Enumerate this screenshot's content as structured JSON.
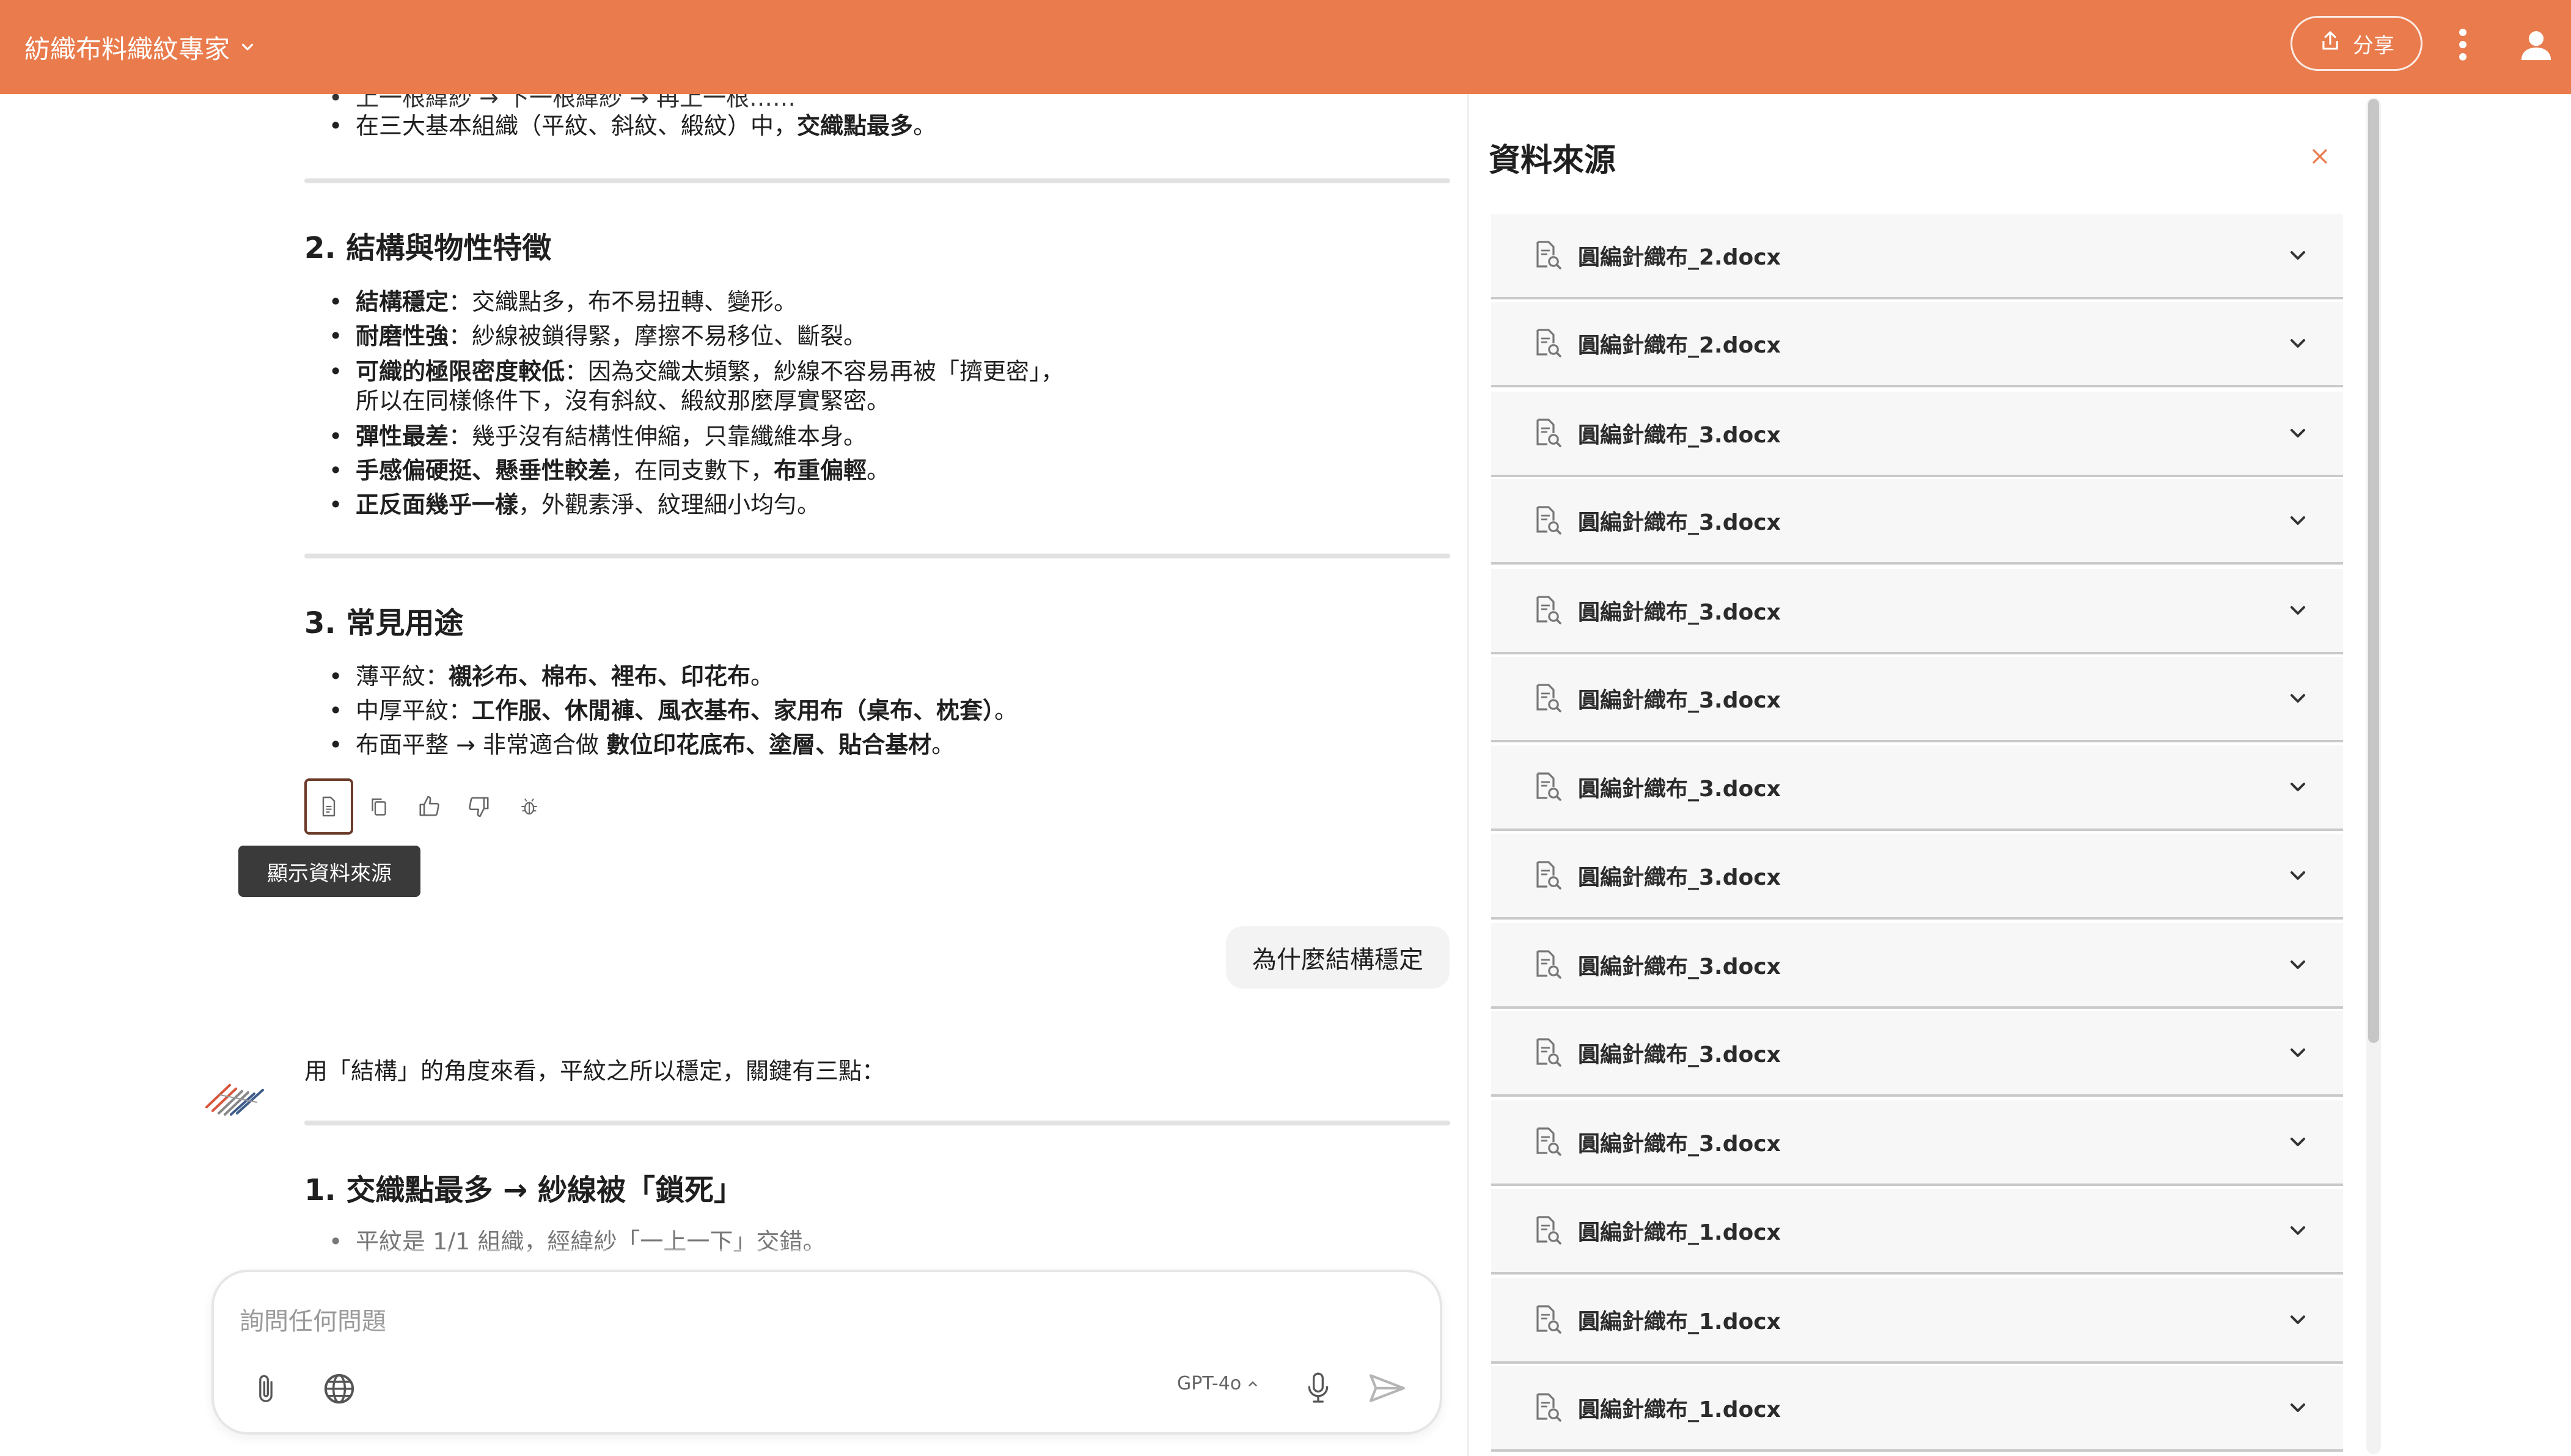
{
  "header": {
    "app_title": "紡織布料織紋專家",
    "share_label": "分享",
    "bg_color": "#e97b4c"
  },
  "chat": {
    "partial_top_line": "上一根緯紗 → 下一根緯紗 → 再上一根……",
    "top_bullet": [
      {
        "pre": "在三大基本組織（平紋、斜紋、緞紋）中，",
        "bold": "交織點最多",
        "post": "。"
      }
    ],
    "section2_title": "2. 結構與物性特徵",
    "section2_items": [
      {
        "bold": "結構穩定",
        "text": "：交織點多，布不易扭轉、變形。"
      },
      {
        "bold": "耐磨性強",
        "text": "：紗線被鎖得緊，摩擦不易移位、斷裂。"
      },
      {
        "bold": "可織的極限密度較低",
        "text": "：因為交織太頻繁，紗線不容易再被「擠更密」，",
        "line2": "所以在同樣條件下，沒有斜紋、緞紋那麼厚實緊密。"
      },
      {
        "bold": "彈性最差",
        "text": "：幾乎沒有結構性伸縮，只靠纖維本身。"
      },
      {
        "bold": "手感偏硬挺、懸垂性較差",
        "text": "，在同支數下，",
        "bold2": "布重偏輕",
        "post": "。"
      },
      {
        "bold": "正反面幾乎一樣",
        "text": "，外觀素淨、紋理細小均勻。"
      }
    ],
    "section3_title": "3. 常見用途",
    "section3_items": [
      {
        "pre": "薄平紋：",
        "bold": "襯衫布、棉布、裡布、印花布",
        "post": "。"
      },
      {
        "pre": "中厚平紋：",
        "bold": "工作服、休閒褲、風衣基布、家用布（桌布、枕套）",
        "post": "。"
      },
      {
        "pre": "布面平整 → 非常適合做 ",
        "bold": "數位印花底布、塗層、貼合基材",
        "post": "。"
      }
    ],
    "tooltip": "顯示資料來源",
    "user_message": "為什麼結構穩定",
    "answer_intro": "用「結構」的角度來看，平紋之所以穩定，關鍵有三點：",
    "answer_section1_title": "1. 交織點最多 → 紗線被「鎖死」",
    "answer_partial_bullet": "平紋是 1/1 組織，經緯紗「一上一下」交錯。"
  },
  "composer": {
    "placeholder": "詢問任何問題",
    "model": "GPT-4o"
  },
  "sources": {
    "title": "資料來源",
    "items": [
      "圓編針織布_2.docx",
      "圓編針織布_2.docx",
      "圓編針織布_3.docx",
      "圓編針織布_3.docx",
      "圓編針織布_3.docx",
      "圓編針織布_3.docx",
      "圓編針織布_3.docx",
      "圓編針織布_3.docx",
      "圓編針織布_3.docx",
      "圓編針織布_3.docx",
      "圓編針織布_3.docx",
      "圓編針織布_1.docx",
      "圓編針織布_1.docx",
      "圓編針織布_1.docx"
    ]
  }
}
